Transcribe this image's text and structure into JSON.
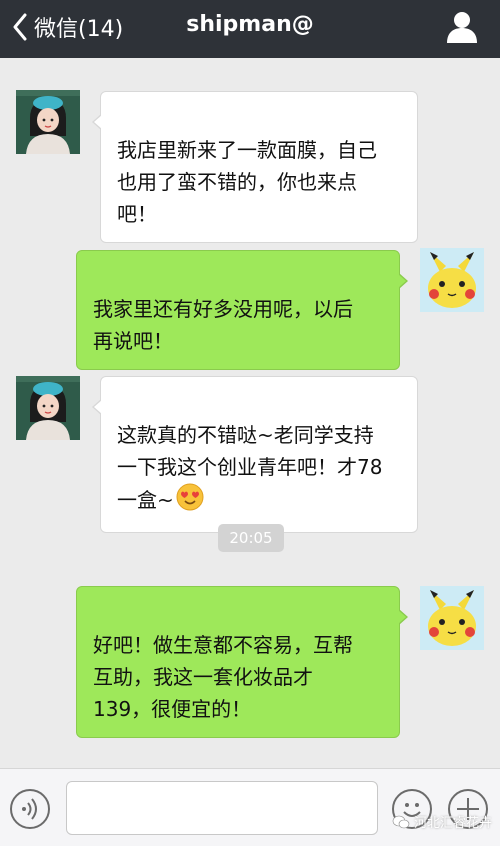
{
  "header": {
    "back_label": "微信(14)",
    "title": "shipman@"
  },
  "messages": [
    {
      "side": "left",
      "avatar": "girl-avatar",
      "text": "我店里新来了一款面膜，自己\n也用了蛮不错的，你也来点\n吧！"
    },
    {
      "side": "right",
      "avatar": "pikachu-avatar",
      "text": "我家里还有好多没用呢，以后\n再说吧！"
    },
    {
      "side": "left",
      "avatar": "girl-avatar",
      "text": "这款真的不错哒~老同学支持\n一下我这个创业青年吧！才78\n一盒~",
      "emoji": "heart-eyes-emoji"
    },
    {
      "side": "right",
      "avatar": "pikachu-avatar",
      "text": "好吧！做生意都不容易，互帮\n互助，我这一套化妆品才\n139，很便宜的！"
    }
  ],
  "timestamp": "20:05",
  "input": {
    "value": "",
    "placeholder": ""
  },
  "watermark": "河北汇睿花卉",
  "colors": {
    "topbar": "#2e3238",
    "chat_bg": "#ebebeb",
    "bubble_sent": "#9ee85a",
    "bubble_received": "#ffffff"
  },
  "icons": {
    "back": "chevron-left-icon",
    "profile": "person-icon",
    "voice": "voice-icon",
    "emoji": "smiley-icon",
    "more": "plus-icon"
  }
}
